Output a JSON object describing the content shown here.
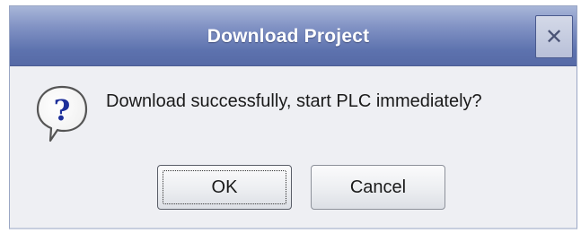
{
  "dialog": {
    "title": "Download Project",
    "close_glyph": "✕",
    "message": "Download successfully, start PLC immediately?",
    "icon": "question-icon",
    "buttons": {
      "ok_label": "OK",
      "cancel_label": "Cancel"
    }
  },
  "colors": {
    "titlebar": "#6275b0",
    "title_text": "#ffffff",
    "body_background": "#eeeff3",
    "icon_blue": "#1d2f9a"
  }
}
